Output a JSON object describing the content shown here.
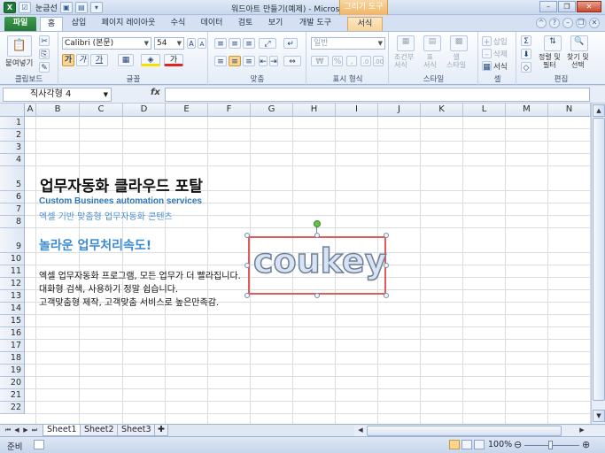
{
  "window": {
    "title": "워드아트 만들기(예제) - Microsoft Excel",
    "context_tab_title": "그리기 도구",
    "qat_label": "눈금선"
  },
  "ribbon_tabs": {
    "file": "파일",
    "home": "홈",
    "insert": "삽입",
    "layout": "페이지 레이아웃",
    "formulas": "수식",
    "data": "데이터",
    "review": "검토",
    "view": "보기",
    "developer": "개발 도구",
    "format": "서식"
  },
  "ribbon": {
    "clipboard": {
      "paste": "붙여넣기",
      "label": "클립보드"
    },
    "font": {
      "name": "Calibri (본문)",
      "size": "54",
      "label": "글꼴",
      "bold": "가",
      "italic": "가",
      "underline": "가"
    },
    "alignment": {
      "label": "맞춤"
    },
    "number": {
      "format": "일반",
      "label": "표시 형식",
      "percent": "%"
    },
    "styles": {
      "conditional": "조건부\n서식",
      "table": "표\n서식",
      "cell_style": "셀\n스타일",
      "label": "스타일"
    },
    "cells": {
      "insert": "삽입",
      "delete": "삭제",
      "format": "서식",
      "label": "셀"
    },
    "editing": {
      "sort": "정렬 및\n필터",
      "find": "찾기 및\n선택",
      "label": "편집"
    }
  },
  "formula_bar": {
    "name_box": "직사각형 4",
    "fx": "fx",
    "value": ""
  },
  "grid": {
    "columns": [
      "A",
      "B",
      "C",
      "D",
      "E",
      "F",
      "G",
      "H",
      "I",
      "J",
      "K",
      "L",
      "M",
      "N"
    ],
    "rows": [
      "1",
      "2",
      "3",
      "4",
      "5",
      "6",
      "7",
      "8",
      "9",
      "10",
      "11",
      "12",
      "13",
      "14",
      "15",
      "16",
      "17",
      "18",
      "19",
      "20",
      "21",
      "22"
    ],
    "title": "업무자동화 클라우드 포탈",
    "subtitle_en": "Custom Businees automation services",
    "subtitle_ko": "엑셀 기반 맞춤형 업무자동화 콘텐츠",
    "headline": "놀라운 업무처리속도!",
    "line1": "엑셀 업무자동화 프로그램, 모든 업무가 더 빨라집니다.",
    "line2": "대화형 검색, 사용하기 정말 쉽습니다.",
    "line3": "고객맞춤형 제작, 고객맞춤 서비스로 높은만족감."
  },
  "wordart": {
    "text": "coukey",
    "outline_color": "#e25a5a"
  },
  "sheets": [
    "Sheet1",
    "Sheet2",
    "Sheet3"
  ],
  "status": {
    "ready": "준비",
    "zoom": "100%"
  },
  "colors": {
    "accent": "#2e75b6",
    "file_tab": "#237a35",
    "context_tab": "#f0b566"
  }
}
